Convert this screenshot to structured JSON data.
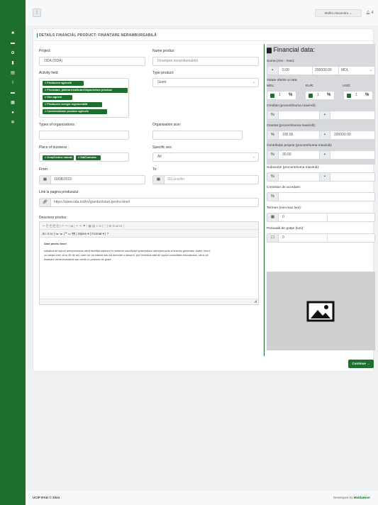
{
  "topbar": {
    "menu_icon": "grid-icon",
    "user_name": "Moffei Alexandru",
    "notifications_count": "4"
  },
  "sidebar": {
    "icons": [
      "home-icon",
      "box-icon",
      "people-icon",
      "document-icon",
      "list-icon",
      "chart-icon",
      "folder-icon",
      "calendar-icon",
      "chat-icon",
      "settings-icon"
    ]
  },
  "page": {
    "title": "DETAILS FINANCIAL PRODUCT: FINANȚARE NERAMBURSABILĂ"
  },
  "form": {
    "project": {
      "label": "Project:",
      "value": "ODA (ODA)"
    },
    "product_name": {
      "label": "Nume produs:",
      "value": "Finanțare nerambursabilă"
    },
    "activity_field": {
      "label": "Activity field:",
      "tags": [
        "Producere agricolă",
        "Procesare, păstrare/calibrare/împachetare produse",
        "Non agricol",
        "Producere energie regenerabilă",
        "Comercializare produse agricole"
      ]
    },
    "type_product": {
      "label": "Type product:",
      "value": "Grant"
    },
    "types_orgs": {
      "label": "Types of organizations :",
      "value": ""
    },
    "org_size": {
      "label": "Organisation size:",
      "value": ""
    },
    "place_business": {
      "label": "Place of business :",
      "tags": [
        "Oraș/Centru raional",
        "Sat/Comuna"
      ]
    },
    "specific_sex": {
      "label": "Specific sex:",
      "value": "All"
    },
    "from": {
      "label": "From:",
      "value": "10/08/2022"
    },
    "to": {
      "label": "To:",
      "placeholder": "Zi/Luna/An"
    },
    "link": {
      "label": "Link la pagina produsului:",
      "value": "https://www.oda.md/ro/granturi/start-pentru-tineri"
    },
    "description": {
      "label": "Descriere produs:",
      "toolbar1": "✂  ⎘  ⎗  ⎗  ⎗  |  ↶  ↷  |  ⇆  |  ⚭  ⚭  ⚑  |  ▦  ▤  ≡  Ω  |  ⛶  |  ⊞ Source  |",
      "toolbar2": "B  I  S  Ix  |  ≔  ≔  |  ❝  ▭  ¶¶  |  Styles    ▾  |  Format    ▾  |  ?",
      "heading": "Start pentru tineri",
      "body1": "Inițiativa de suport antreprenorial oferă facilități sistimea în vederea valorificării potențialului antreprenorial al tinerilor generație. Astfel, tinerii",
      "body2": "cu vârsta între 18 și 35 de ani, care vor să inițieze sau să dezvolte o afacere, pot beneficia atât de suport consultativ-educațional, cât și de",
      "body3": "finanțare nerambursabilă sau credit cu porțiune de grant."
    }
  },
  "financial": {
    "title": "Financial data:",
    "sum_label": "Suma (min - max):",
    "sum_min": "0.00",
    "sum_max": "200000.00",
    "currency": "MDL",
    "valute_label": "Valute oferite și rata:",
    "mdl_label": "MDL:",
    "eur_label": "EUR:",
    "usd_label": "USD:",
    "mdl_rate": "1",
    "eur_rate": "1",
    "usd_rate": "1",
    "credit_label": "Creditat (procent/suma maximă):",
    "grant_label": "Grantat (procent/suma maximă):",
    "grant_pct": "100.00",
    "grant_max": "200000.00",
    "contrib_label": "Contribuție proprie (procent/suma maximă):",
    "contrib_pct": "30.00",
    "subventie_label": "Subvenție (procent/suma maximă):",
    "comision_label": "Comision de acordare:",
    "termen_label": "Termen (min-max luni):",
    "termen_min": "0",
    "perioada_label": "Perioadă de grație (luni):",
    "perioada_min": "0",
    "image_icon": "image-placeholder-icon"
  },
  "actions": {
    "continue": "Continue →"
  },
  "footer": {
    "left": "UCIP IFAD © 2024",
    "right_prefix": "Developed by ",
    "right_brand": "MoldaHost"
  }
}
